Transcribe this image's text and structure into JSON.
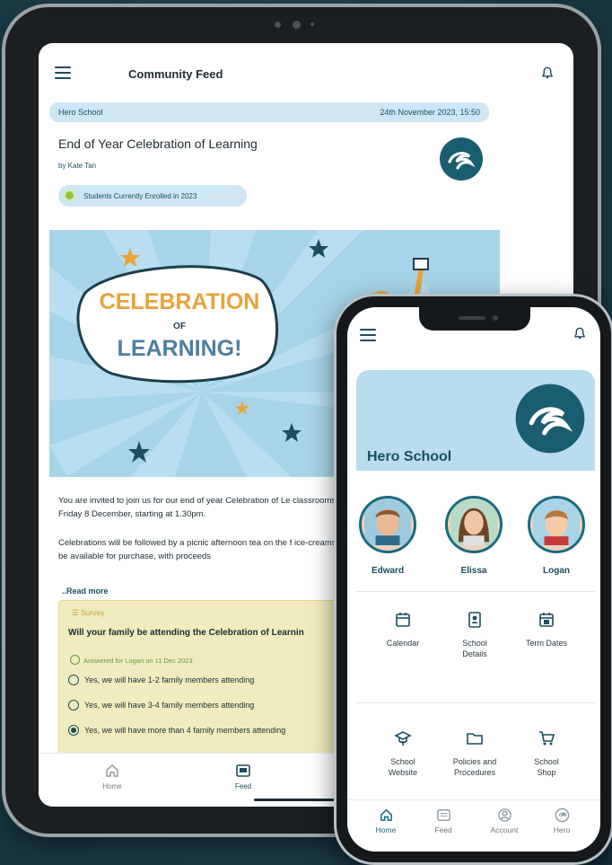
{
  "tablet": {
    "header": {
      "title": "Community Feed"
    },
    "post": {
      "school": "Hero School",
      "datetime": "24th November 2023, 15:50",
      "title": "End of Year Celebration of Learning",
      "author": "by Kate Tan",
      "audience": "Students Currently Enrolled in 2023",
      "banner": {
        "line1": "CELEBRATION",
        "line2": "OF",
        "line3": "LEARNING!"
      },
      "body1": "You are invited to join us for our end of year Celebration of Le classrooms on Friday 8 December, starting at 1.30pm.",
      "body2": "Celebrations will be followed by a picnic afternoon tea on the f ice-creams will be available for purchase, with proceeds",
      "read_more": "..Read more"
    },
    "survey": {
      "tag": "Survey",
      "question": "Will your family be attending the Celebration of Learnin",
      "answered": "Answered for Logan on 11 Dec 2023",
      "options": [
        {
          "label": "Yes, we will have 1-2 family members attending",
          "selected": false
        },
        {
          "label": "Yes, we will have 3-4 family members attending",
          "selected": false
        },
        {
          "label": "Yes, we will have more than 4 family members attending",
          "selected": true
        }
      ]
    },
    "nav": [
      {
        "label": "Home",
        "icon": "home-icon",
        "active": false
      },
      {
        "label": "Feed",
        "icon": "feed-icon",
        "active": true
      }
    ]
  },
  "phone": {
    "school_name": "Hero School",
    "children": [
      {
        "name": "Edward"
      },
      {
        "name": "Elissa"
      },
      {
        "name": "Logan"
      }
    ],
    "tiles": [
      {
        "label": "Calendar",
        "icon": "calendar-icon"
      },
      {
        "label": "School\nDetails",
        "icon": "contact-book-icon"
      },
      {
        "label": "Term Dates",
        "icon": "calendar-12-icon"
      },
      {
        "label": "School\nWebsite",
        "icon": "graduation-cap-icon"
      },
      {
        "label": "Policies and\nProcedures",
        "icon": "folder-icon"
      },
      {
        "label": "School\nShop",
        "icon": "cart-icon"
      }
    ],
    "nav": [
      {
        "label": "Home",
        "icon": "home-icon",
        "active": true
      },
      {
        "label": "Feed",
        "icon": "feed-icon",
        "active": false
      },
      {
        "label": "Account",
        "icon": "account-icon",
        "active": false
      },
      {
        "label": "Hero",
        "icon": "hero-icon",
        "active": false
      }
    ]
  },
  "colors": {
    "accent": "#1b4e5e",
    "hero_bg": "#b9ddee",
    "survey_bg": "#f1ecbf",
    "banner_orange": "#e8a33a"
  }
}
